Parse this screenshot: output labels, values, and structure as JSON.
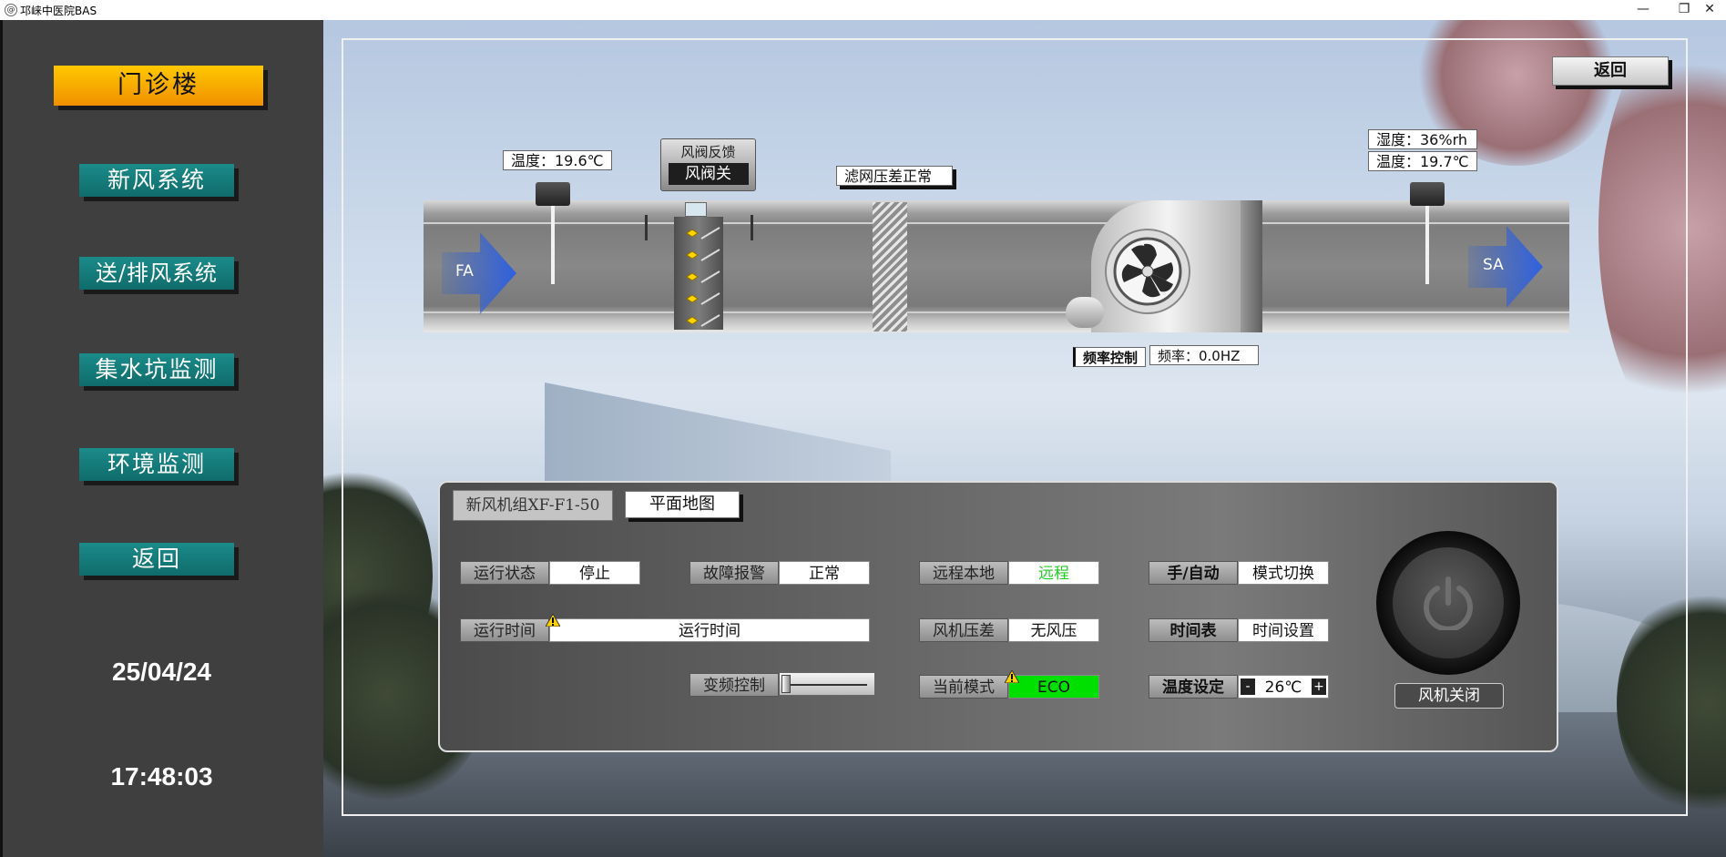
{
  "window": {
    "title": "邛崃中医院BAS",
    "minimize": "—",
    "restore": "❐",
    "close": "✕"
  },
  "sidebar": {
    "building": "门诊楼",
    "items": [
      "新风系统",
      "送/排风系统",
      "集水坑监测",
      "环境监测",
      "返回"
    ],
    "date": "25/04/24",
    "time": "17:48:03"
  },
  "top": {
    "back_label": "返回"
  },
  "duct": {
    "inlet_temp": "温度：19.6℃",
    "valve_title": "风阀反馈",
    "valve_state": "风阀关",
    "filter_status": "滤网压差正常",
    "outlet_humidity": "湿度：36%rh",
    "outlet_temp": "温度：19.7℃",
    "fa_label": "FA",
    "sa_label": "SA",
    "freq_control_label": "频率控制",
    "frequency": "频率：0.0HZ"
  },
  "panel": {
    "unit_tab": "新风机组XF-F1-50",
    "map_tab": "平面地图",
    "run_status_label": "运行状态",
    "run_status_value": "停止",
    "fault_label": "故障报警",
    "fault_value": "正常",
    "remote_label": "远程本地",
    "remote_value": "远程",
    "auto_label": "手/自动",
    "mode_switch": "模式切换",
    "run_time_label": "运行时间",
    "run_time_value": "运行时间",
    "pressure_label": "风机压差",
    "pressure_value": "无风压",
    "schedule_label": "时间表",
    "time_setting": "时间设置",
    "vfd_label": "变频控制",
    "vfd_level": 0,
    "mode_label": "当前模式",
    "mode_value": "ECO",
    "temp_set_label": "温度设定",
    "temp_minus": "-",
    "temp_value": "26℃",
    "temp_plus": "+",
    "fan_state": "风机关闭"
  },
  "colors": {
    "nav_bg": "#137a79",
    "building_btn": "#ffb400",
    "remote_text": "#22cc22",
    "eco_bg": "#00e000"
  }
}
